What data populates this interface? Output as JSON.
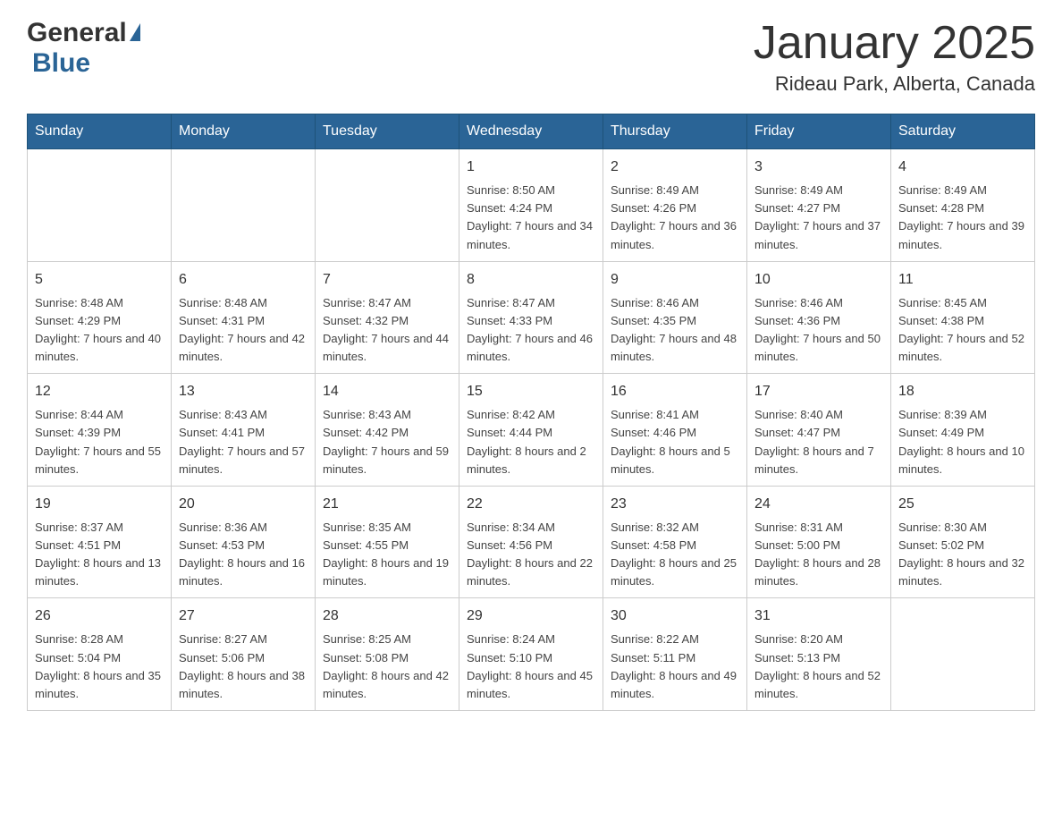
{
  "header": {
    "logo_general": "General",
    "logo_blue": "Blue",
    "month_title": "January 2025",
    "location": "Rideau Park, Alberta, Canada"
  },
  "weekdays": [
    "Sunday",
    "Monday",
    "Tuesday",
    "Wednesday",
    "Thursday",
    "Friday",
    "Saturday"
  ],
  "weeks": [
    [
      {
        "day": "",
        "sunrise": "",
        "sunset": "",
        "daylight": ""
      },
      {
        "day": "",
        "sunrise": "",
        "sunset": "",
        "daylight": ""
      },
      {
        "day": "",
        "sunrise": "",
        "sunset": "",
        "daylight": ""
      },
      {
        "day": "1",
        "sunrise": "Sunrise: 8:50 AM",
        "sunset": "Sunset: 4:24 PM",
        "daylight": "Daylight: 7 hours and 34 minutes."
      },
      {
        "day": "2",
        "sunrise": "Sunrise: 8:49 AM",
        "sunset": "Sunset: 4:26 PM",
        "daylight": "Daylight: 7 hours and 36 minutes."
      },
      {
        "day": "3",
        "sunrise": "Sunrise: 8:49 AM",
        "sunset": "Sunset: 4:27 PM",
        "daylight": "Daylight: 7 hours and 37 minutes."
      },
      {
        "day": "4",
        "sunrise": "Sunrise: 8:49 AM",
        "sunset": "Sunset: 4:28 PM",
        "daylight": "Daylight: 7 hours and 39 minutes."
      }
    ],
    [
      {
        "day": "5",
        "sunrise": "Sunrise: 8:48 AM",
        "sunset": "Sunset: 4:29 PM",
        "daylight": "Daylight: 7 hours and 40 minutes."
      },
      {
        "day": "6",
        "sunrise": "Sunrise: 8:48 AM",
        "sunset": "Sunset: 4:31 PM",
        "daylight": "Daylight: 7 hours and 42 minutes."
      },
      {
        "day": "7",
        "sunrise": "Sunrise: 8:47 AM",
        "sunset": "Sunset: 4:32 PM",
        "daylight": "Daylight: 7 hours and 44 minutes."
      },
      {
        "day": "8",
        "sunrise": "Sunrise: 8:47 AM",
        "sunset": "Sunset: 4:33 PM",
        "daylight": "Daylight: 7 hours and 46 minutes."
      },
      {
        "day": "9",
        "sunrise": "Sunrise: 8:46 AM",
        "sunset": "Sunset: 4:35 PM",
        "daylight": "Daylight: 7 hours and 48 minutes."
      },
      {
        "day": "10",
        "sunrise": "Sunrise: 8:46 AM",
        "sunset": "Sunset: 4:36 PM",
        "daylight": "Daylight: 7 hours and 50 minutes."
      },
      {
        "day": "11",
        "sunrise": "Sunrise: 8:45 AM",
        "sunset": "Sunset: 4:38 PM",
        "daylight": "Daylight: 7 hours and 52 minutes."
      }
    ],
    [
      {
        "day": "12",
        "sunrise": "Sunrise: 8:44 AM",
        "sunset": "Sunset: 4:39 PM",
        "daylight": "Daylight: 7 hours and 55 minutes."
      },
      {
        "day": "13",
        "sunrise": "Sunrise: 8:43 AM",
        "sunset": "Sunset: 4:41 PM",
        "daylight": "Daylight: 7 hours and 57 minutes."
      },
      {
        "day": "14",
        "sunrise": "Sunrise: 8:43 AM",
        "sunset": "Sunset: 4:42 PM",
        "daylight": "Daylight: 7 hours and 59 minutes."
      },
      {
        "day": "15",
        "sunrise": "Sunrise: 8:42 AM",
        "sunset": "Sunset: 4:44 PM",
        "daylight": "Daylight: 8 hours and 2 minutes."
      },
      {
        "day": "16",
        "sunrise": "Sunrise: 8:41 AM",
        "sunset": "Sunset: 4:46 PM",
        "daylight": "Daylight: 8 hours and 5 minutes."
      },
      {
        "day": "17",
        "sunrise": "Sunrise: 8:40 AM",
        "sunset": "Sunset: 4:47 PM",
        "daylight": "Daylight: 8 hours and 7 minutes."
      },
      {
        "day": "18",
        "sunrise": "Sunrise: 8:39 AM",
        "sunset": "Sunset: 4:49 PM",
        "daylight": "Daylight: 8 hours and 10 minutes."
      }
    ],
    [
      {
        "day": "19",
        "sunrise": "Sunrise: 8:37 AM",
        "sunset": "Sunset: 4:51 PM",
        "daylight": "Daylight: 8 hours and 13 minutes."
      },
      {
        "day": "20",
        "sunrise": "Sunrise: 8:36 AM",
        "sunset": "Sunset: 4:53 PM",
        "daylight": "Daylight: 8 hours and 16 minutes."
      },
      {
        "day": "21",
        "sunrise": "Sunrise: 8:35 AM",
        "sunset": "Sunset: 4:55 PM",
        "daylight": "Daylight: 8 hours and 19 minutes."
      },
      {
        "day": "22",
        "sunrise": "Sunrise: 8:34 AM",
        "sunset": "Sunset: 4:56 PM",
        "daylight": "Daylight: 8 hours and 22 minutes."
      },
      {
        "day": "23",
        "sunrise": "Sunrise: 8:32 AM",
        "sunset": "Sunset: 4:58 PM",
        "daylight": "Daylight: 8 hours and 25 minutes."
      },
      {
        "day": "24",
        "sunrise": "Sunrise: 8:31 AM",
        "sunset": "Sunset: 5:00 PM",
        "daylight": "Daylight: 8 hours and 28 minutes."
      },
      {
        "day": "25",
        "sunrise": "Sunrise: 8:30 AM",
        "sunset": "Sunset: 5:02 PM",
        "daylight": "Daylight: 8 hours and 32 minutes."
      }
    ],
    [
      {
        "day": "26",
        "sunrise": "Sunrise: 8:28 AM",
        "sunset": "Sunset: 5:04 PM",
        "daylight": "Daylight: 8 hours and 35 minutes."
      },
      {
        "day": "27",
        "sunrise": "Sunrise: 8:27 AM",
        "sunset": "Sunset: 5:06 PM",
        "daylight": "Daylight: 8 hours and 38 minutes."
      },
      {
        "day": "28",
        "sunrise": "Sunrise: 8:25 AM",
        "sunset": "Sunset: 5:08 PM",
        "daylight": "Daylight: 8 hours and 42 minutes."
      },
      {
        "day": "29",
        "sunrise": "Sunrise: 8:24 AM",
        "sunset": "Sunset: 5:10 PM",
        "daylight": "Daylight: 8 hours and 45 minutes."
      },
      {
        "day": "30",
        "sunrise": "Sunrise: 8:22 AM",
        "sunset": "Sunset: 5:11 PM",
        "daylight": "Daylight: 8 hours and 49 minutes."
      },
      {
        "day": "31",
        "sunrise": "Sunrise: 8:20 AM",
        "sunset": "Sunset: 5:13 PM",
        "daylight": "Daylight: 8 hours and 52 minutes."
      },
      {
        "day": "",
        "sunrise": "",
        "sunset": "",
        "daylight": ""
      }
    ]
  ]
}
